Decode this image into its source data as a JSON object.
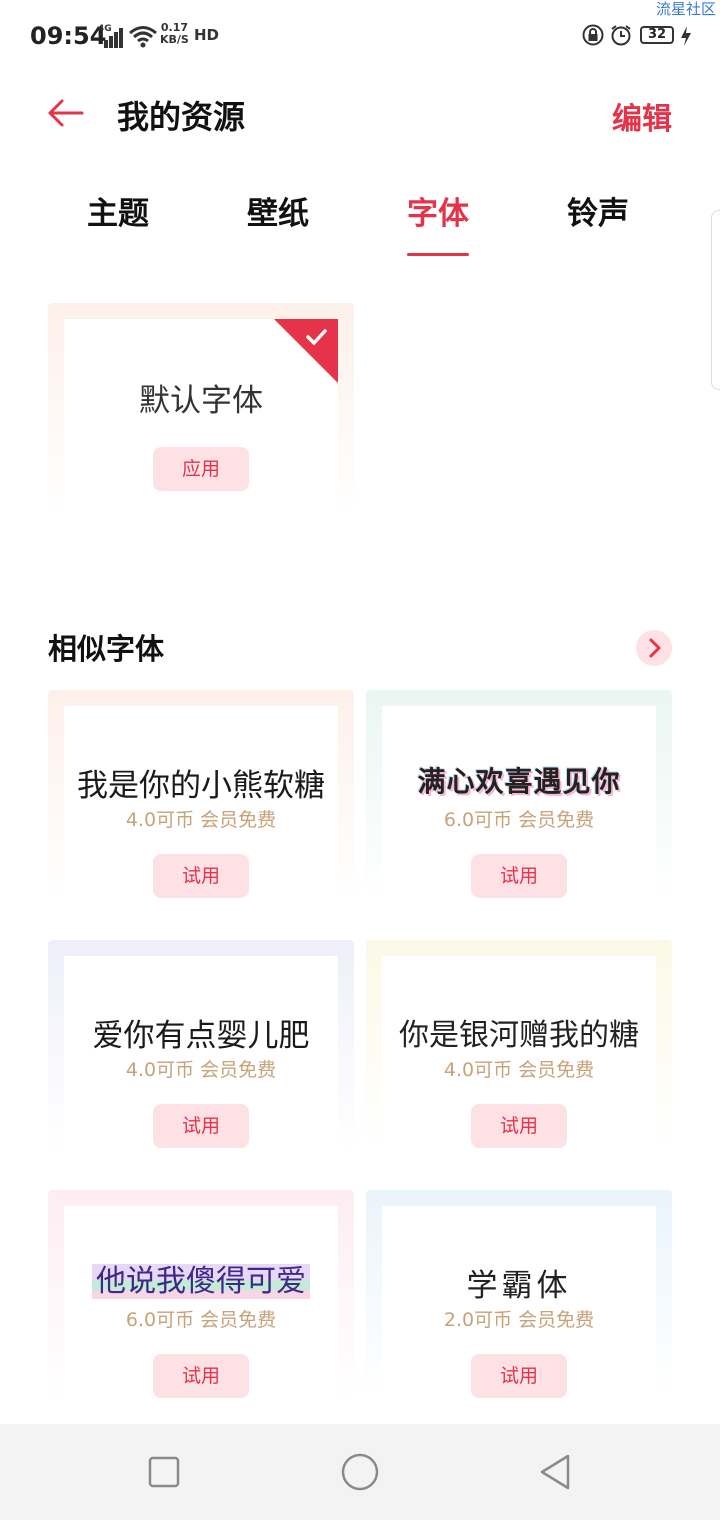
{
  "status_bar": {
    "time": "09:54",
    "network": "4G",
    "speed_value": "0.17",
    "speed_unit": "KB/S",
    "hd": "HD",
    "battery": "32",
    "watermark": "流星社区"
  },
  "header": {
    "title": "我的资源",
    "edit_label": "编辑",
    "back_icon": "arrow-left-icon"
  },
  "tabs": [
    {
      "label": "主题",
      "active": false
    },
    {
      "label": "壁纸",
      "active": false
    },
    {
      "label": "字体",
      "active": true
    },
    {
      "label": "铃声",
      "active": false
    }
  ],
  "owned": {
    "name": "默认字体",
    "button": "应用",
    "selected": true
  },
  "similar": {
    "title": "相似字体",
    "items": [
      {
        "name": "我是你的小熊软糖",
        "price": "4.0可币  会员免费",
        "button": "试用"
      },
      {
        "name": "满心欢喜遇见你",
        "price": "6.0可币  会员免费",
        "button": "试用"
      },
      {
        "name": "爱你有点婴儿肥",
        "price": "4.0可币  会员免费",
        "button": "试用"
      },
      {
        "name": "你是银河赠我的糖",
        "price": "4.0可币  会员免费",
        "button": "试用"
      },
      {
        "name": "他说我傻得可爱",
        "price": "6.0可币  会员免费",
        "button": "试用"
      },
      {
        "name": "学霸体",
        "price": "2.0可币  会员免费",
        "button": "试用"
      }
    ]
  },
  "colors": {
    "accent": "#e5334a",
    "button_bg": "#fde1e5",
    "price": "#c8a279"
  }
}
